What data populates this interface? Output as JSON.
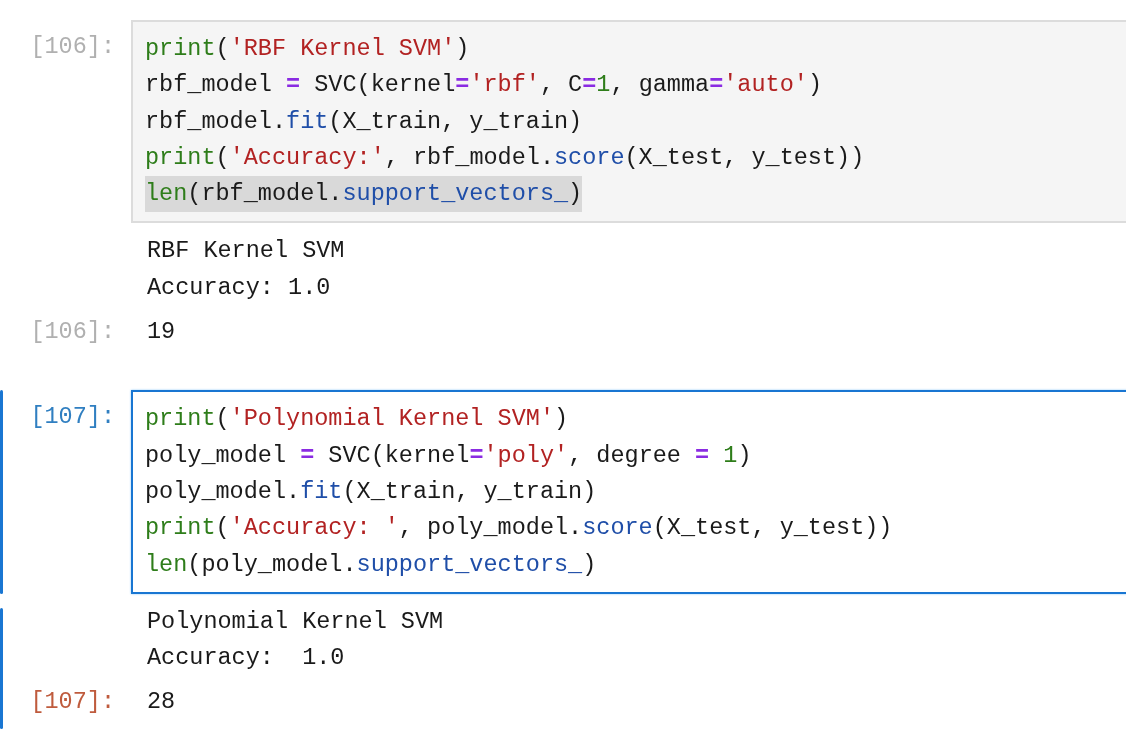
{
  "cells": [
    {
      "prompt": "[106]:",
      "selected": false,
      "code": [
        {
          "highlighted": false,
          "tokens": [
            {
              "kind": "builtin",
              "text": "print"
            },
            {
              "kind": "plain",
              "text": "("
            },
            {
              "kind": "string",
              "text": "'RBF Kernel SVM'"
            },
            {
              "kind": "plain",
              "text": ")"
            }
          ]
        },
        {
          "highlighted": false,
          "tokens": [
            {
              "kind": "plain",
              "text": "rbf_model "
            },
            {
              "kind": "operator",
              "text": "="
            },
            {
              "kind": "plain",
              "text": " SVC(kernel"
            },
            {
              "kind": "operator",
              "text": "="
            },
            {
              "kind": "string",
              "text": "'rbf'"
            },
            {
              "kind": "plain",
              "text": ", C"
            },
            {
              "kind": "operator",
              "text": "="
            },
            {
              "kind": "number",
              "text": "1"
            },
            {
              "kind": "plain",
              "text": ", gamma"
            },
            {
              "kind": "operator",
              "text": "="
            },
            {
              "kind": "string",
              "text": "'auto'"
            },
            {
              "kind": "plain",
              "text": ")"
            }
          ]
        },
        {
          "highlighted": false,
          "tokens": [
            {
              "kind": "plain",
              "text": "rbf_model."
            },
            {
              "kind": "attr",
              "text": "fit"
            },
            {
              "kind": "plain",
              "text": "(X_train, y_train)"
            }
          ]
        },
        {
          "highlighted": false,
          "tokens": [
            {
              "kind": "builtin",
              "text": "print"
            },
            {
              "kind": "plain",
              "text": "("
            },
            {
              "kind": "string",
              "text": "'Accuracy:'"
            },
            {
              "kind": "plain",
              "text": ", rbf_model."
            },
            {
              "kind": "attr",
              "text": "score"
            },
            {
              "kind": "plain",
              "text": "(X_test, y_test))"
            }
          ]
        },
        {
          "highlighted": true,
          "tokens": [
            {
              "kind": "builtin",
              "text": "len"
            },
            {
              "kind": "plain",
              "text": "(rbf_model."
            },
            {
              "kind": "attr",
              "text": "support_vectors_"
            },
            {
              "kind": "plain",
              "text": ")"
            }
          ]
        }
      ],
      "stdout": [
        "RBF Kernel SVM",
        "Accuracy: 1.0"
      ],
      "result_prompt": "[106]:",
      "result": "19"
    },
    {
      "prompt": "[107]:",
      "selected": true,
      "code": [
        {
          "highlighted": false,
          "tokens": [
            {
              "kind": "builtin",
              "text": "print"
            },
            {
              "kind": "plain",
              "text": "("
            },
            {
              "kind": "string",
              "text": "'Polynomial Kernel SVM'"
            },
            {
              "kind": "plain",
              "text": ")"
            }
          ]
        },
        {
          "highlighted": false,
          "tokens": [
            {
              "kind": "plain",
              "text": "poly_model "
            },
            {
              "kind": "operator",
              "text": "="
            },
            {
              "kind": "plain",
              "text": " SVC(kernel"
            },
            {
              "kind": "operator",
              "text": "="
            },
            {
              "kind": "string",
              "text": "'poly'"
            },
            {
              "kind": "plain",
              "text": ", degree "
            },
            {
              "kind": "operator",
              "text": "="
            },
            {
              "kind": "number",
              "text": " 1"
            },
            {
              "kind": "plain",
              "text": ")"
            }
          ]
        },
        {
          "highlighted": false,
          "tokens": [
            {
              "kind": "plain",
              "text": "poly_model."
            },
            {
              "kind": "attr",
              "text": "fit"
            },
            {
              "kind": "plain",
              "text": "(X_train, y_train)"
            }
          ]
        },
        {
          "highlighted": false,
          "tokens": [
            {
              "kind": "builtin",
              "text": "print"
            },
            {
              "kind": "plain",
              "text": "("
            },
            {
              "kind": "string",
              "text": "'Accuracy: '"
            },
            {
              "kind": "plain",
              "text": ", poly_model."
            },
            {
              "kind": "attr",
              "text": "score"
            },
            {
              "kind": "plain",
              "text": "(X_test, y_test))"
            }
          ]
        },
        {
          "highlighted": false,
          "tokens": [
            {
              "kind": "builtin",
              "text": "len"
            },
            {
              "kind": "plain",
              "text": "(poly_model."
            },
            {
              "kind": "attr",
              "text": "support_vectors_"
            },
            {
              "kind": "plain",
              "text": ")"
            }
          ]
        }
      ],
      "stdout": [
        "Polynomial Kernel SVM",
        "Accuracy:  1.0"
      ],
      "result_prompt": "[107]:",
      "result": "28"
    }
  ]
}
